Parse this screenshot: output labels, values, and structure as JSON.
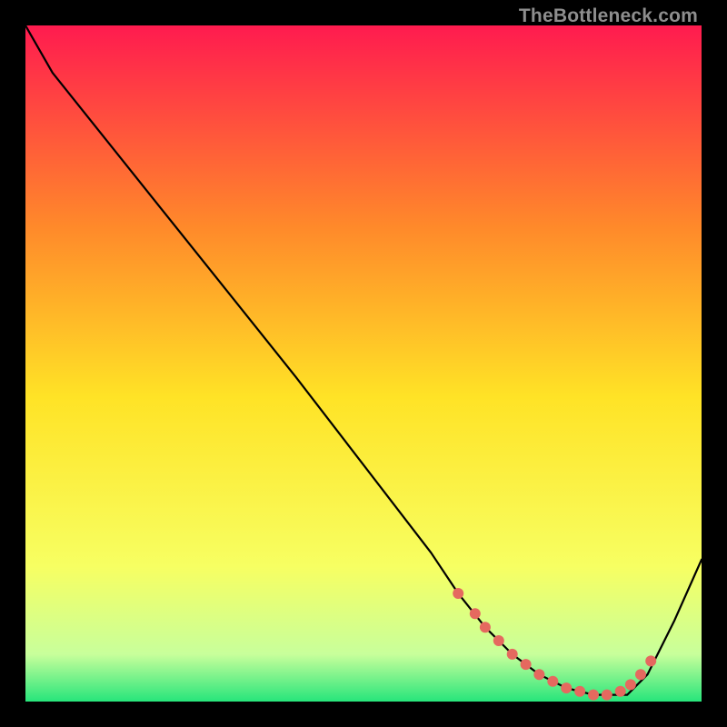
{
  "watermark": "TheBottleneck.com",
  "colors": {
    "top": "#ff1b4f",
    "mid_upper": "#ff8a2a",
    "mid": "#ffe326",
    "mid_lower": "#f7ff62",
    "green_pale": "#c8ff9b",
    "green": "#27e57b",
    "curve": "#000000",
    "marker": "#e5695f",
    "background": "#000000"
  },
  "chart_data": {
    "type": "line",
    "title": "",
    "xlabel": "",
    "ylabel": "",
    "xlim": [
      0,
      100
    ],
    "ylim": [
      0,
      100
    ],
    "curve": {
      "x": [
        0,
        4,
        20,
        40,
        60,
        64,
        68,
        72,
        76,
        80,
        84,
        87,
        89,
        92,
        96,
        100
      ],
      "y": [
        100,
        93,
        73,
        48,
        22,
        16,
        11,
        7,
        4,
        2,
        1,
        1,
        1,
        4,
        12,
        21
      ]
    },
    "markers": {
      "x": [
        64,
        66.5,
        68,
        70,
        72,
        74,
        76,
        78,
        80,
        82,
        84,
        86,
        88,
        89.5,
        91,
        92.5
      ],
      "y": [
        16,
        13,
        11,
        9,
        7,
        5.5,
        4,
        3,
        2,
        1.5,
        1,
        1,
        1.5,
        2.5,
        4,
        6
      ]
    }
  }
}
